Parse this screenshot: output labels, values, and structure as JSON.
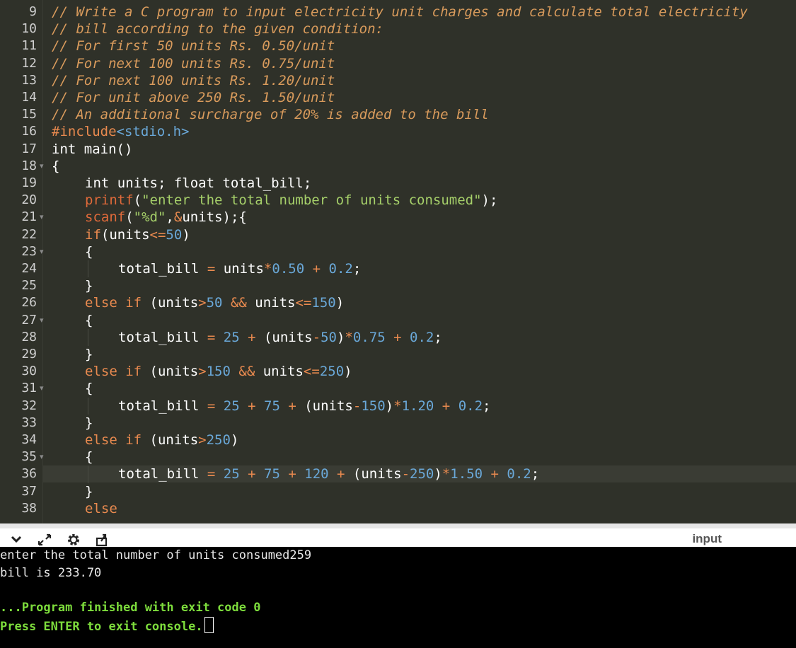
{
  "editor": {
    "lines": [
      {
        "num": "9",
        "fold": false,
        "indent": 0,
        "tokens": [
          [
            "comment",
            "// Write a C program to input electricity unit charges and calculate total electricity"
          ]
        ]
      },
      {
        "num": "10",
        "fold": false,
        "indent": 0,
        "tokens": [
          [
            "comment",
            "// bill according to the given condition:"
          ]
        ]
      },
      {
        "num": "11",
        "fold": false,
        "indent": 0,
        "tokens": [
          [
            "comment",
            "// For first 50 units Rs. 0.50/unit"
          ]
        ]
      },
      {
        "num": "12",
        "fold": false,
        "indent": 0,
        "tokens": [
          [
            "comment",
            "// For next 100 units Rs. 0.75/unit"
          ]
        ]
      },
      {
        "num": "13",
        "fold": false,
        "indent": 0,
        "tokens": [
          [
            "comment",
            "// For next 100 units Rs. 1.20/unit"
          ]
        ]
      },
      {
        "num": "14",
        "fold": false,
        "indent": 0,
        "tokens": [
          [
            "comment",
            "// For unit above 250 Rs. 1.50/unit"
          ]
        ]
      },
      {
        "num": "15",
        "fold": false,
        "indent": 0,
        "tokens": [
          [
            "comment",
            "// An additional surcharge of 20% is added to the bill"
          ]
        ]
      },
      {
        "num": "16",
        "fold": false,
        "indent": 0,
        "tokens": [
          [
            "pre",
            "#include"
          ],
          [
            "hdr",
            "<stdio.h>"
          ]
        ]
      },
      {
        "num": "17",
        "fold": false,
        "indent": 0,
        "tokens": [
          [
            "plain",
            "int main()"
          ]
        ]
      },
      {
        "num": "18",
        "fold": true,
        "indent": 0,
        "tokens": [
          [
            "plain",
            "{"
          ]
        ]
      },
      {
        "num": "19",
        "fold": false,
        "indent": 1,
        "tokens": [
          [
            "plain",
            "int units; float total_bill;"
          ]
        ]
      },
      {
        "num": "20",
        "fold": false,
        "indent": 1,
        "tokens": [
          [
            "fn",
            "printf"
          ],
          [
            "plain",
            "("
          ],
          [
            "str",
            "\"enter the total number of units consumed\""
          ],
          [
            "plain",
            ");"
          ]
        ]
      },
      {
        "num": "21",
        "fold": true,
        "indent": 1,
        "tokens": [
          [
            "fn",
            "scanf"
          ],
          [
            "plain",
            "("
          ],
          [
            "str",
            "\"%d\""
          ],
          [
            "plain",
            ","
          ],
          [
            "op",
            "&"
          ],
          [
            "plain",
            "units);{"
          ]
        ]
      },
      {
        "num": "22",
        "fold": false,
        "indent": 1,
        "tokens": [
          [
            "kw",
            "if"
          ],
          [
            "plain",
            "(units"
          ],
          [
            "op",
            "<="
          ],
          [
            "num",
            "50"
          ],
          [
            "plain",
            ")"
          ]
        ]
      },
      {
        "num": "23",
        "fold": true,
        "indent": 1,
        "tokens": [
          [
            "plain",
            "{"
          ]
        ]
      },
      {
        "num": "24",
        "fold": false,
        "indent": 2,
        "tokens": [
          [
            "plain",
            "total_bill "
          ],
          [
            "op",
            "="
          ],
          [
            "plain",
            " units"
          ],
          [
            "op",
            "*"
          ],
          [
            "num",
            "0.50"
          ],
          [
            "plain",
            " "
          ],
          [
            "op",
            "+"
          ],
          [
            "plain",
            " "
          ],
          [
            "num",
            "0.2"
          ],
          [
            "plain",
            ";"
          ]
        ]
      },
      {
        "num": "25",
        "fold": false,
        "indent": 1,
        "tokens": [
          [
            "plain",
            "}"
          ]
        ]
      },
      {
        "num": "26",
        "fold": false,
        "indent": 1,
        "tokens": [
          [
            "kw",
            "else if"
          ],
          [
            "plain",
            " (units"
          ],
          [
            "op",
            ">"
          ],
          [
            "num",
            "50"
          ],
          [
            "plain",
            " "
          ],
          [
            "op",
            "&&"
          ],
          [
            "plain",
            " units"
          ],
          [
            "op",
            "<="
          ],
          [
            "num",
            "150"
          ],
          [
            "plain",
            ")"
          ]
        ]
      },
      {
        "num": "27",
        "fold": true,
        "indent": 1,
        "tokens": [
          [
            "plain",
            "{"
          ]
        ]
      },
      {
        "num": "28",
        "fold": false,
        "indent": 2,
        "tokens": [
          [
            "plain",
            "total_bill "
          ],
          [
            "op",
            "="
          ],
          [
            "plain",
            " "
          ],
          [
            "num",
            "25"
          ],
          [
            "plain",
            " "
          ],
          [
            "op",
            "+"
          ],
          [
            "plain",
            " (units"
          ],
          [
            "op",
            "-"
          ],
          [
            "num",
            "50"
          ],
          [
            "plain",
            ")"
          ],
          [
            "op",
            "*"
          ],
          [
            "num",
            "0.75"
          ],
          [
            "plain",
            " "
          ],
          [
            "op",
            "+"
          ],
          [
            "plain",
            " "
          ],
          [
            "num",
            "0.2"
          ],
          [
            "plain",
            ";"
          ]
        ]
      },
      {
        "num": "29",
        "fold": false,
        "indent": 1,
        "tokens": [
          [
            "plain",
            "}"
          ]
        ]
      },
      {
        "num": "30",
        "fold": false,
        "indent": 1,
        "tokens": [
          [
            "kw",
            "else if"
          ],
          [
            "plain",
            " (units"
          ],
          [
            "op",
            ">"
          ],
          [
            "num",
            "150"
          ],
          [
            "plain",
            " "
          ],
          [
            "op",
            "&&"
          ],
          [
            "plain",
            " units"
          ],
          [
            "op",
            "<="
          ],
          [
            "num",
            "250"
          ],
          [
            "plain",
            ")"
          ]
        ]
      },
      {
        "num": "31",
        "fold": true,
        "indent": 1,
        "tokens": [
          [
            "plain",
            "{"
          ]
        ]
      },
      {
        "num": "32",
        "fold": false,
        "indent": 2,
        "tokens": [
          [
            "plain",
            "total_bill "
          ],
          [
            "op",
            "="
          ],
          [
            "plain",
            " "
          ],
          [
            "num",
            "25"
          ],
          [
            "plain",
            " "
          ],
          [
            "op",
            "+"
          ],
          [
            "plain",
            " "
          ],
          [
            "num",
            "75"
          ],
          [
            "plain",
            " "
          ],
          [
            "op",
            "+"
          ],
          [
            "plain",
            " (units"
          ],
          [
            "op",
            "-"
          ],
          [
            "num",
            "150"
          ],
          [
            "plain",
            ")"
          ],
          [
            "op",
            "*"
          ],
          [
            "num",
            "1.20"
          ],
          [
            "plain",
            " "
          ],
          [
            "op",
            "+"
          ],
          [
            "plain",
            " "
          ],
          [
            "num",
            "0.2"
          ],
          [
            "plain",
            ";"
          ]
        ]
      },
      {
        "num": "33",
        "fold": false,
        "indent": 1,
        "tokens": [
          [
            "plain",
            "}"
          ]
        ]
      },
      {
        "num": "34",
        "fold": false,
        "indent": 1,
        "tokens": [
          [
            "kw",
            "else if"
          ],
          [
            "plain",
            " (units"
          ],
          [
            "op",
            ">"
          ],
          [
            "num",
            "250"
          ],
          [
            "plain",
            ")"
          ]
        ]
      },
      {
        "num": "35",
        "fold": true,
        "indent": 1,
        "tokens": [
          [
            "plain",
            "{"
          ]
        ]
      },
      {
        "num": "36",
        "fold": false,
        "indent": 2,
        "active": true,
        "tokens": [
          [
            "plain",
            "total_bill "
          ],
          [
            "op",
            "="
          ],
          [
            "plain",
            " "
          ],
          [
            "num",
            "25"
          ],
          [
            "plain",
            " "
          ],
          [
            "op",
            "+"
          ],
          [
            "plain",
            " "
          ],
          [
            "num",
            "75"
          ],
          [
            "plain",
            " "
          ],
          [
            "op",
            "+"
          ],
          [
            "plain",
            " "
          ],
          [
            "num",
            "120"
          ],
          [
            "plain",
            " "
          ],
          [
            "op",
            "+"
          ],
          [
            "plain",
            " (units"
          ],
          [
            "op",
            "-"
          ],
          [
            "num",
            "250"
          ],
          [
            "plain",
            ")"
          ],
          [
            "op",
            "*"
          ],
          [
            "num",
            "1.50"
          ],
          [
            "plain",
            " "
          ],
          [
            "op",
            "+"
          ],
          [
            "plain",
            " "
          ],
          [
            "num",
            "0.2"
          ],
          [
            "plain",
            ";"
          ]
        ]
      },
      {
        "num": "37",
        "fold": false,
        "indent": 1,
        "tokens": [
          [
            "plain",
            "}"
          ]
        ]
      },
      {
        "num": "38",
        "fold": false,
        "indent": 1,
        "tokens": [
          [
            "kw",
            "else"
          ]
        ]
      }
    ],
    "colors": {
      "comment": "#d99b5c",
      "pre": "#e98a4f",
      "hdr": "#6aa8d8",
      "plain": "#ffffff",
      "fn": "#e06a3a",
      "str": "#a6d06a",
      "kw": "#e98a4f",
      "op": "#e98a4f",
      "num": "#6aa8d8"
    }
  },
  "toolbar": {
    "icons": [
      "chevron-down-icon",
      "expand-icon",
      "gear-icon",
      "share-icon"
    ],
    "input_label": "input"
  },
  "console": {
    "lines": [
      {
        "text": "enter the total number of units consumed259",
        "style": "plain"
      },
      {
        "text": "bill is 233.70",
        "style": "plain"
      },
      {
        "text": "",
        "style": "plain"
      },
      {
        "text": "...Program finished with exit code 0",
        "style": "green"
      },
      {
        "text": "Press ENTER to exit console.",
        "style": "green",
        "cursor": true
      }
    ]
  }
}
